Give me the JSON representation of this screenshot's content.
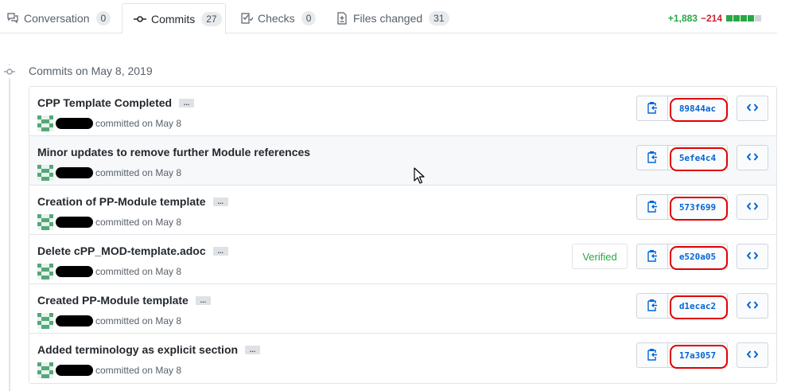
{
  "tabs": [
    {
      "label": "Conversation",
      "count": "0",
      "icon": "comment-icon",
      "active": false
    },
    {
      "label": "Commits",
      "count": "27",
      "icon": "git-commit-icon",
      "active": true
    },
    {
      "label": "Checks",
      "count": "0",
      "icon": "checklist-icon",
      "active": false
    },
    {
      "label": "Files changed",
      "count": "31",
      "icon": "file-diff-icon",
      "active": false
    }
  ],
  "diffstat": {
    "additions": "+1,883",
    "deletions": "−214",
    "colors": {
      "add": "#28a745",
      "del": "#cb2431",
      "neutral": "#d1d5da"
    }
  },
  "timeline": {
    "heading": "Commits on May 8, 2019"
  },
  "commits": [
    {
      "title": "CPP Template Completed",
      "meta": "committed on May 8",
      "sha": "89844ac",
      "verified": ""
    },
    {
      "title": "Minor updates to remove further Module references",
      "meta": "committed on May 8",
      "sha": "5efe4c4",
      "verified": ""
    },
    {
      "title": "Creation of PP-Module template",
      "meta": "committed on May 8",
      "sha": "573f699",
      "verified": ""
    },
    {
      "title": "Delete cPP_MOD-template.adoc",
      "meta": "committed on May 8",
      "sha": "e520a05",
      "verified": "Verified"
    },
    {
      "title": "Created PP-Module template",
      "meta": "committed on May 8",
      "sha": "d1ecac2",
      "verified": ""
    },
    {
      "title": "Added terminology as explicit section",
      "meta": "committed on May 8",
      "sha": "17a3057",
      "verified": ""
    }
  ],
  "icons": {
    "copy": "clipboard-icon",
    "browse": "code-icon",
    "expander": "ellipsis-icon"
  },
  "expander_label": "..."
}
